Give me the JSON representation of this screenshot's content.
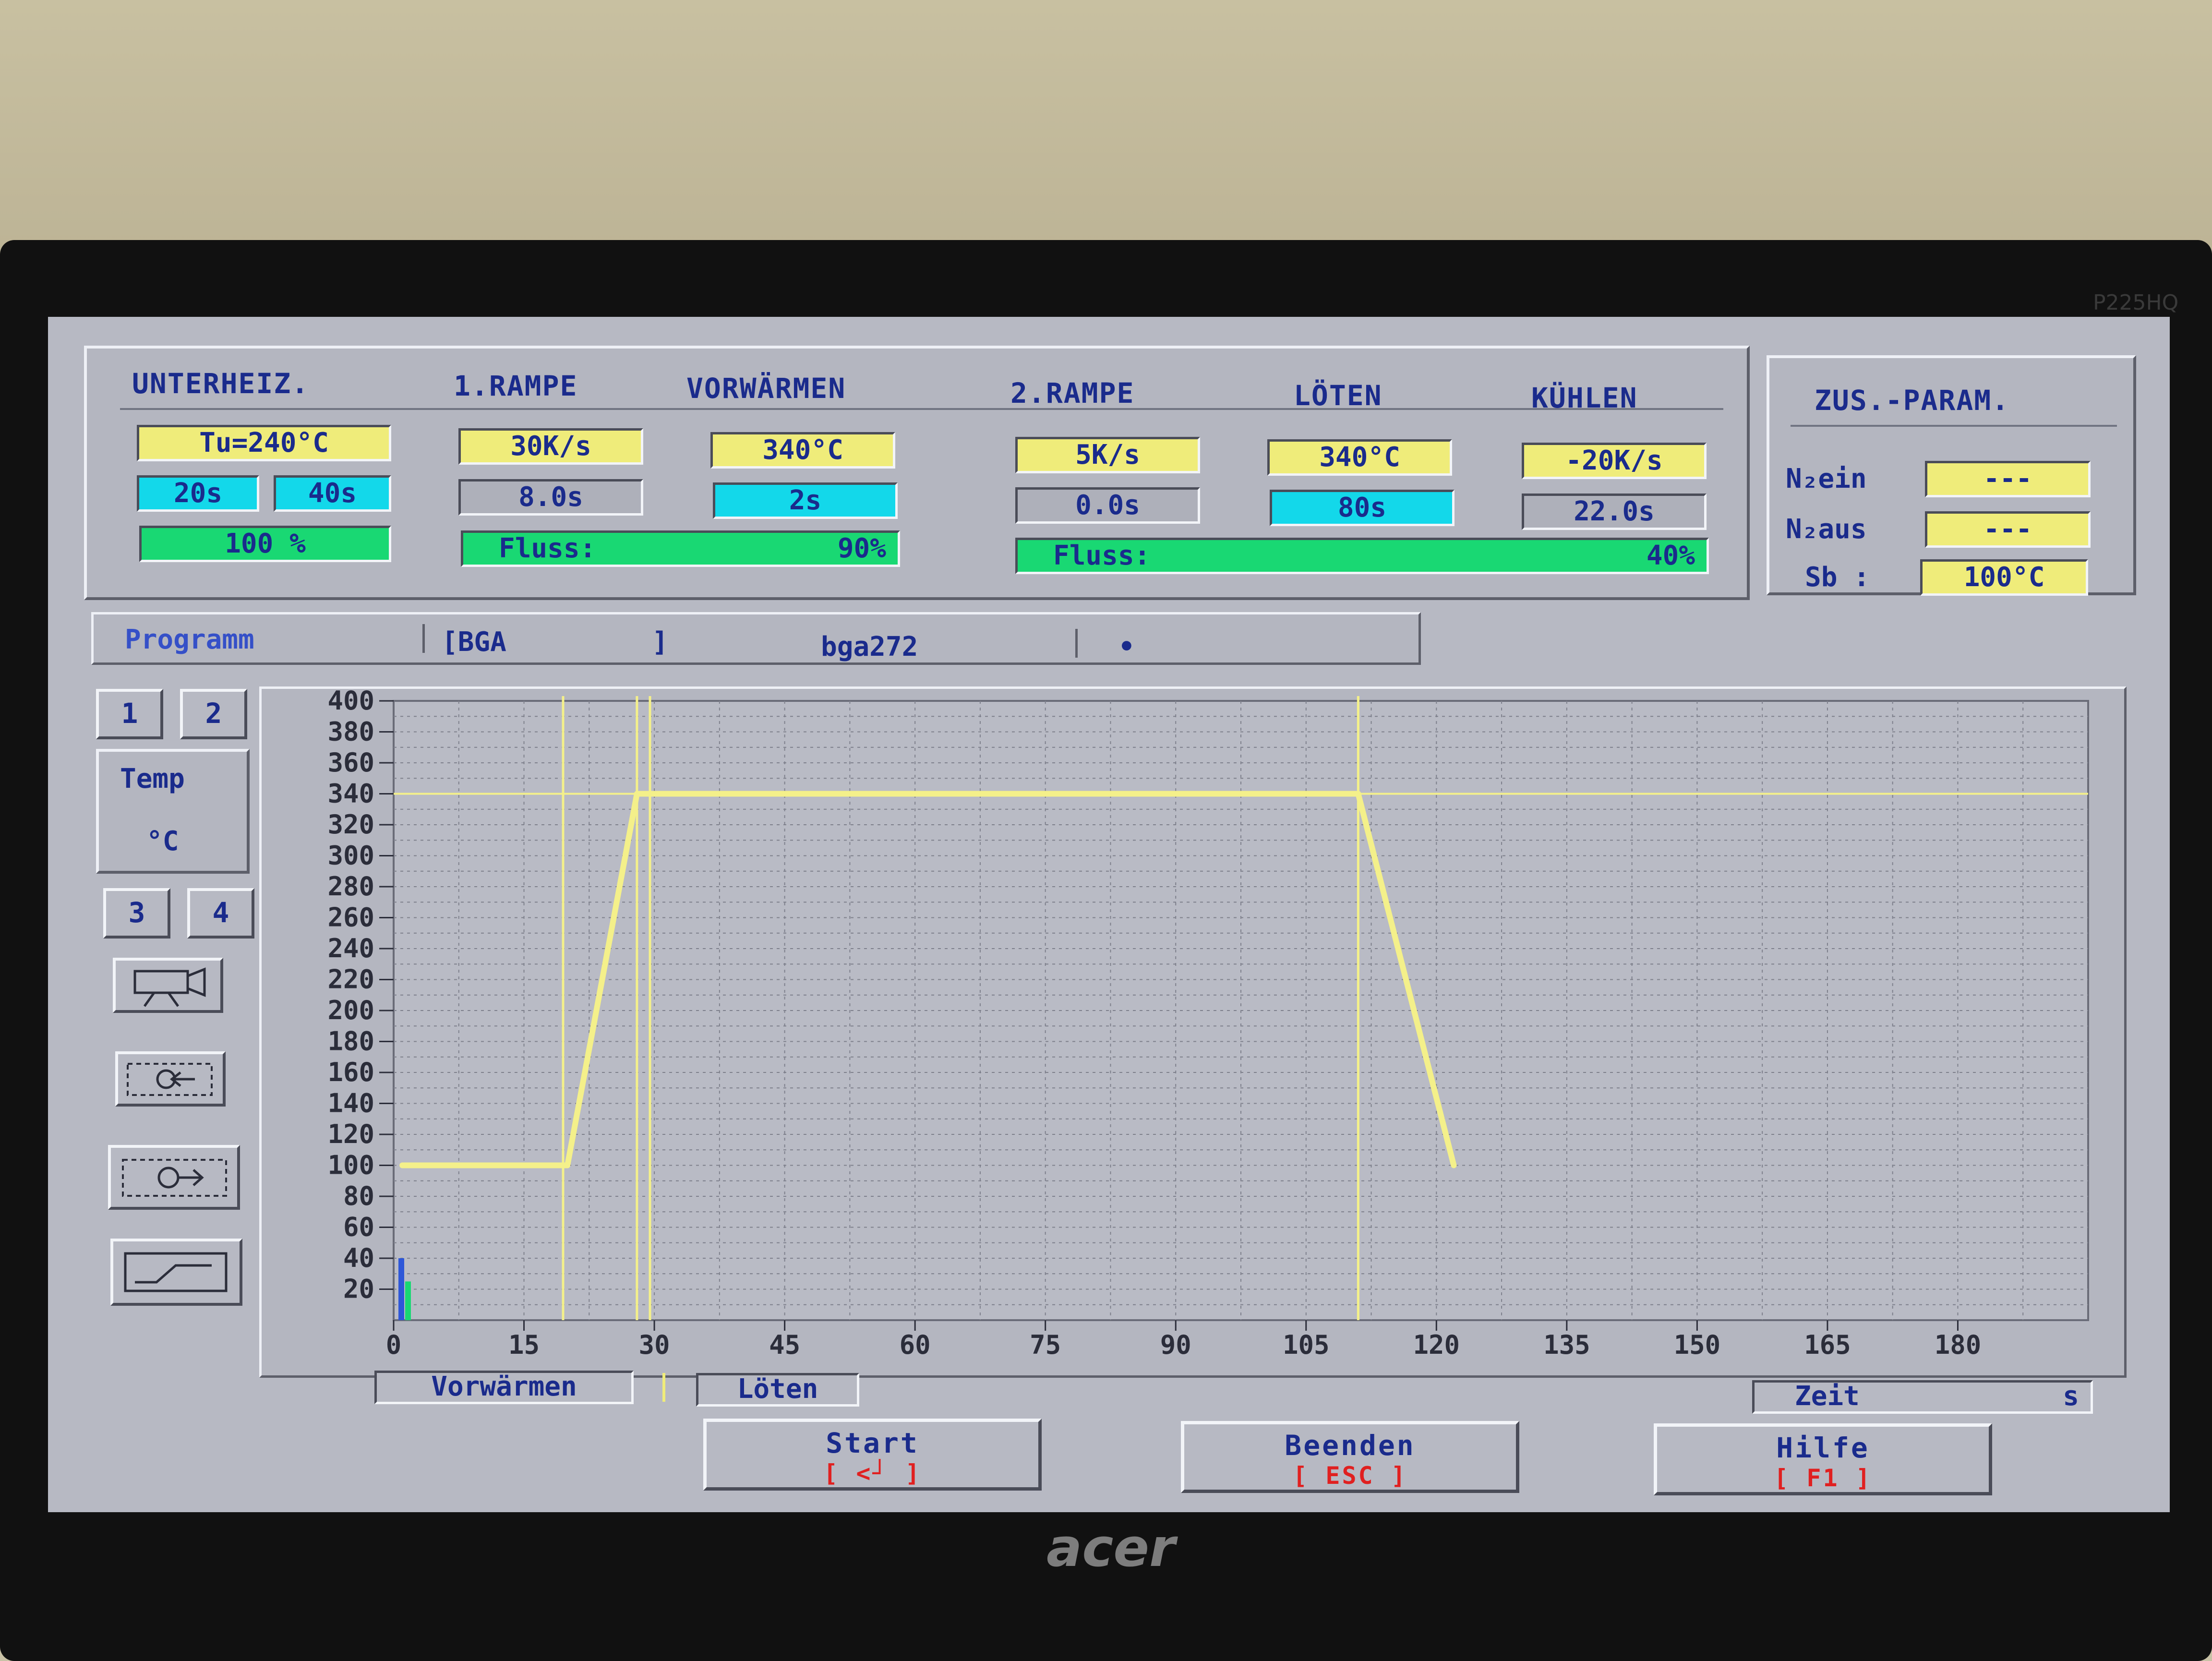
{
  "header": {
    "unterheiz": "UNTERHEIZ.",
    "rampe1": "1.RAMPE",
    "vorwaermen": "VORWÄRMEN",
    "rampe2": "2.RAMPE",
    "loeten": "LÖTEN",
    "kuehlen": "KÜHLEN",
    "zus_param": "ZUS.-PARAM."
  },
  "params": {
    "unterheiz_temp": "Tu=240°C",
    "unterheiz_t1": "20s",
    "unterheiz_t2": "40s",
    "unterheiz_pct": "100 %",
    "rampe1_rate": "30K/s",
    "rampe1_time": "8.0s",
    "fluss1_label": "Fluss:",
    "fluss1_value": "90%",
    "vorwaermen_temp": "340°C",
    "vorwaermen_time": "2s",
    "rampe2_rate": "5K/s",
    "rampe2_time": "0.0s",
    "fluss2_label": "Fluss:",
    "fluss2_value": "40%",
    "loeten_temp": "340°C",
    "loeten_time": "80s",
    "kuehlen_rate": "-20K/s",
    "kuehlen_time": "22.0s"
  },
  "zus": {
    "n2_ein_label": "N₂ein",
    "n2_ein_value": "---",
    "n2_aus_label": "N₂aus",
    "n2_aus_value": "---",
    "sb_label": "Sb :",
    "sb_value": "100°C"
  },
  "program": {
    "label": "Programm",
    "group": "[BGA         ]",
    "name": "bga272",
    "marker": "•"
  },
  "side": {
    "btn1": "1",
    "btn2": "2",
    "temp_label": "Temp",
    "unit_label": "°C",
    "btn3": "3",
    "btn4": "4",
    "icon_camera": "camera-icon",
    "icon_zoom_out": "zoom-out-icon",
    "icon_zoom_in": "zoom-in-icon",
    "icon_profile": "profile-curve-icon"
  },
  "bottom": {
    "vorwaermen_tab": "Vorwärmen",
    "loeten_tab": "Löten",
    "zeit_label": "Zeit",
    "zeit_unit": "s"
  },
  "buttons": {
    "start_label": "Start",
    "start_key": "[ <┘ ]",
    "beenden_label": "Beenden",
    "beenden_key": "[ ESC ]",
    "hilfe_label": "Hilfe",
    "hilfe_key": "[ F1 ]"
  },
  "monitor": {
    "brand": "acer",
    "model": "P225HQ"
  },
  "colors": {
    "profile_line": "#f4f08a",
    "grid_bg": "#b9bbc5",
    "text_blue": "#1a2b8c"
  },
  "chart_data": {
    "type": "line",
    "x_ticks": [
      0,
      15,
      30,
      45,
      60,
      75,
      90,
      105,
      120,
      135,
      150,
      165,
      180
    ],
    "y_ticks": [
      20,
      40,
      60,
      80,
      100,
      120,
      140,
      160,
      180,
      200,
      220,
      240,
      260,
      280,
      300,
      320,
      340,
      360,
      380,
      400
    ],
    "xlim": [
      0,
      195
    ],
    "ylim": [
      0,
      400
    ],
    "xlabel": "Zeit",
    "ylabel": "Temp °C",
    "grid": true,
    "series": [
      {
        "values_xy": [
          [
            1,
            100
          ],
          [
            20,
            100
          ],
          [
            28,
            340
          ],
          [
            111,
            340
          ],
          [
            122,
            100
          ]
        ]
      }
    ],
    "reference_line_y": 340,
    "phase_markers_x": [
      19.5,
      28,
      29.5,
      111
    ]
  }
}
